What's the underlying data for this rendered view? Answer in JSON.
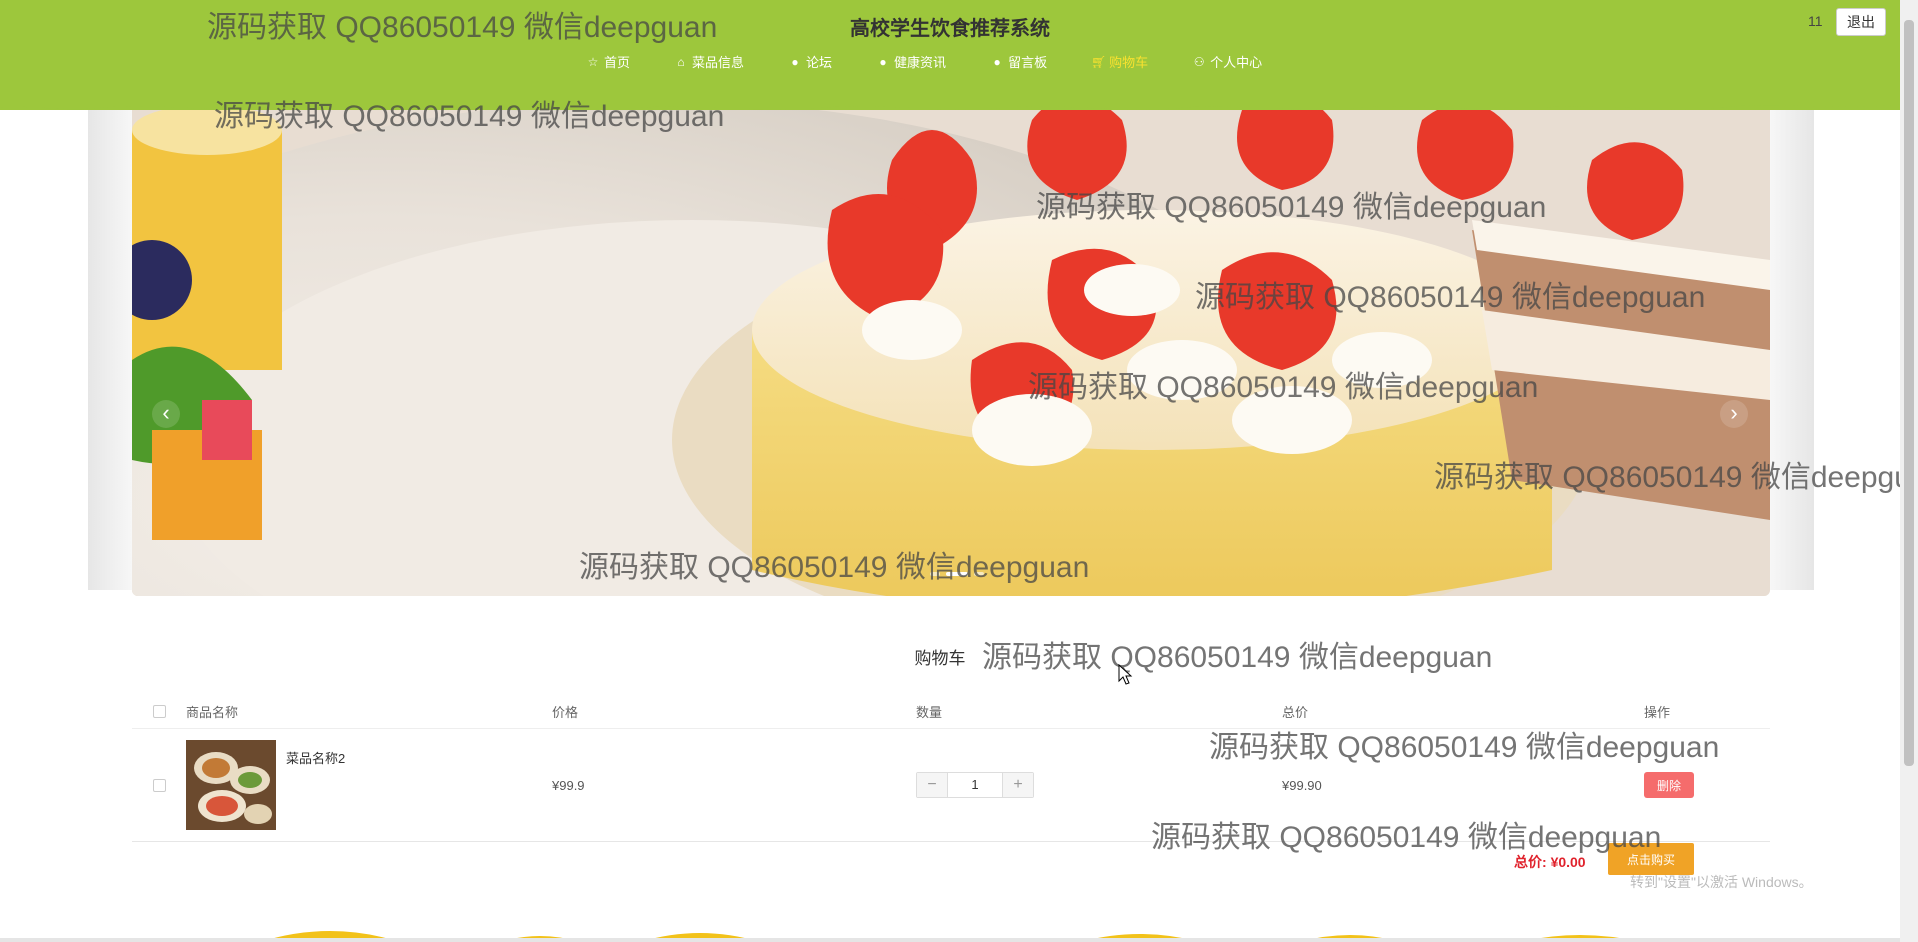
{
  "header": {
    "title": "高校学生饮食推荐系统",
    "user_name": "11",
    "logout_label": "退出",
    "bg_color": "#9dc73c"
  },
  "nav": {
    "items": [
      {
        "label": "首页",
        "icon": "star-icon"
      },
      {
        "label": "菜品信息",
        "icon": "bag-icon"
      },
      {
        "label": "论坛",
        "icon": "circle-icon"
      },
      {
        "label": "健康资讯",
        "icon": "circle-icon"
      },
      {
        "label": "留言板",
        "icon": "circle-icon"
      },
      {
        "label": "购物车",
        "icon": "cart-icon",
        "active": true
      },
      {
        "label": "个人中心",
        "icon": "user-icon"
      }
    ]
  },
  "banner": {
    "prev": "‹",
    "next": "›"
  },
  "cart": {
    "title": "购物车",
    "columns": [
      "商品名称",
      "价格",
      "数量",
      "总价",
      "操作"
    ],
    "rows": [
      {
        "name": "菜品名称2",
        "price": "¥99.9",
        "quantity": "1",
        "total": "¥99.90",
        "action": "删除"
      }
    ],
    "total_label": "总价:",
    "total_value": "¥0.00",
    "buy_label": "点击购买",
    "minus": "−",
    "plus": "+"
  },
  "watermark": "源码获取 QQ86050149 微信deepguan",
  "os_notice": {
    "line1": "indows",
    "line2": "转到\"设置\"以激活 Windows。"
  }
}
